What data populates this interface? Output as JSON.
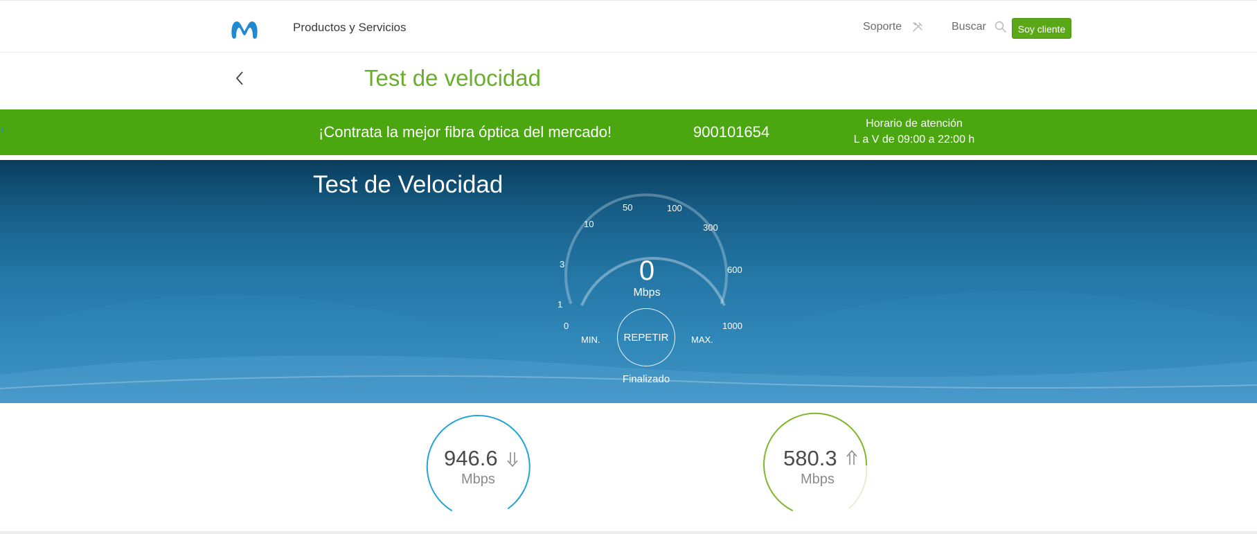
{
  "header": {
    "products_label": "Productos y Servicios",
    "support_label": "Soporte",
    "search_label": "Buscar",
    "client_button": "Soy cliente",
    "brand_color": "#1f8ad1",
    "accent_color": "#5aa817"
  },
  "title_row": {
    "title": "Test de velocidad",
    "back_icon": "chevron-left-icon"
  },
  "promo": {
    "text": "¡Contrata la mejor fibra óptica del mercado!",
    "phone": "900101654",
    "hours_title": "Horario de atención",
    "hours_time": "L a V de 09:00 a 22:00 h",
    "background": "#4ba70f"
  },
  "hero": {
    "title": "Test de Velocidad",
    "gauge_ticks": [
      "0",
      "1",
      "3",
      "10",
      "50",
      "100",
      "300",
      "600",
      "1000"
    ],
    "current_speed": "0",
    "unit": "Mbps",
    "min_label": "MIN.",
    "max_label": "MAX.",
    "repeat_button": "REPETIR",
    "status": "Finalizado"
  },
  "results": {
    "download": {
      "value": "946.6",
      "unit": "Mbps",
      "icon": "download-arrow-icon",
      "color": "#21a4d6"
    },
    "upload": {
      "value": "580.3",
      "unit": "Mbps",
      "icon": "upload-arrow-icon",
      "color": "#7fb628"
    }
  }
}
